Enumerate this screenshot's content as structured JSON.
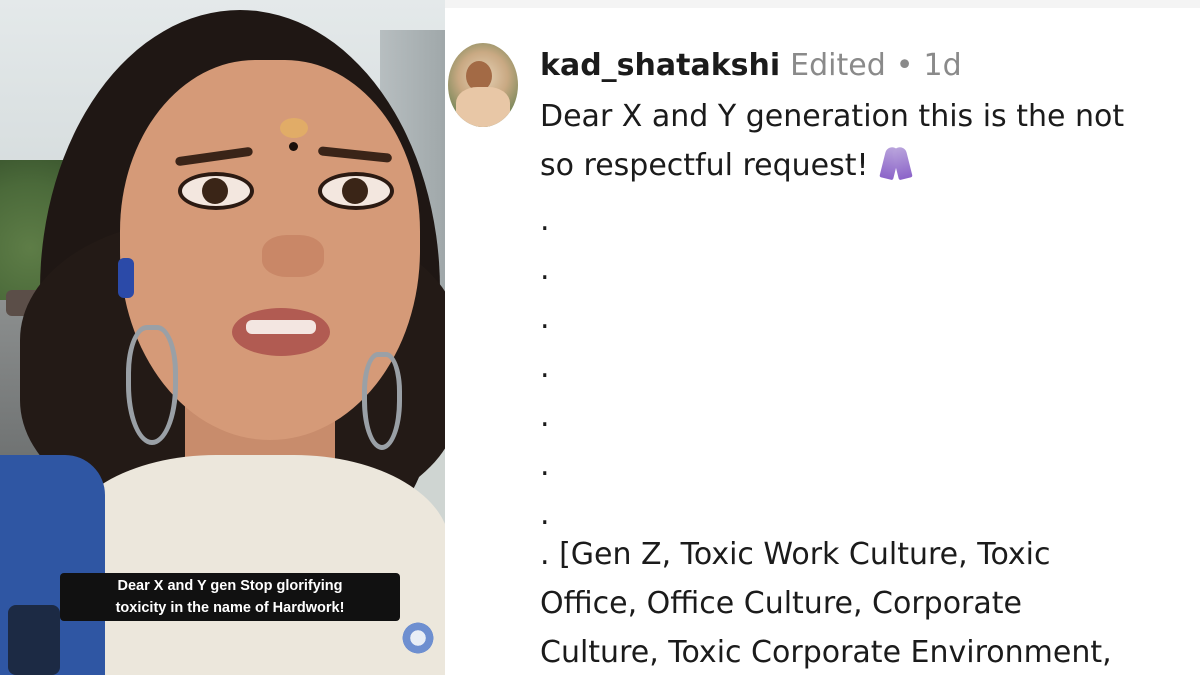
{
  "video": {
    "caption_line1": "Dear X and Y gen Stop glorifying",
    "caption_line2": "toxicity in the name of Hardwork!"
  },
  "comment": {
    "username": "kad_shatakshi",
    "edited_label": "Edited",
    "separator": "•",
    "timestamp": "1d",
    "text_line1": "Dear X and Y generation this is the not",
    "text_line2": "so respectful request!",
    "emoji_icon": "folded-hands-icon",
    "dots": [
      ".",
      ".",
      ".",
      ".",
      ".",
      ".",
      "."
    ],
    "tags_line1": ". [Gen Z, Toxic Work Culture, Toxic",
    "tags_line2": "Office, Office Culture, Corporate",
    "tags_line3": "Culture, Toxic Corporate Environment,"
  },
  "colors": {
    "caption_bg": "#111111",
    "username": "#1b1b1b",
    "meta_gray": "#8a8a8a",
    "emoji_purple": "#8c64c9"
  }
}
